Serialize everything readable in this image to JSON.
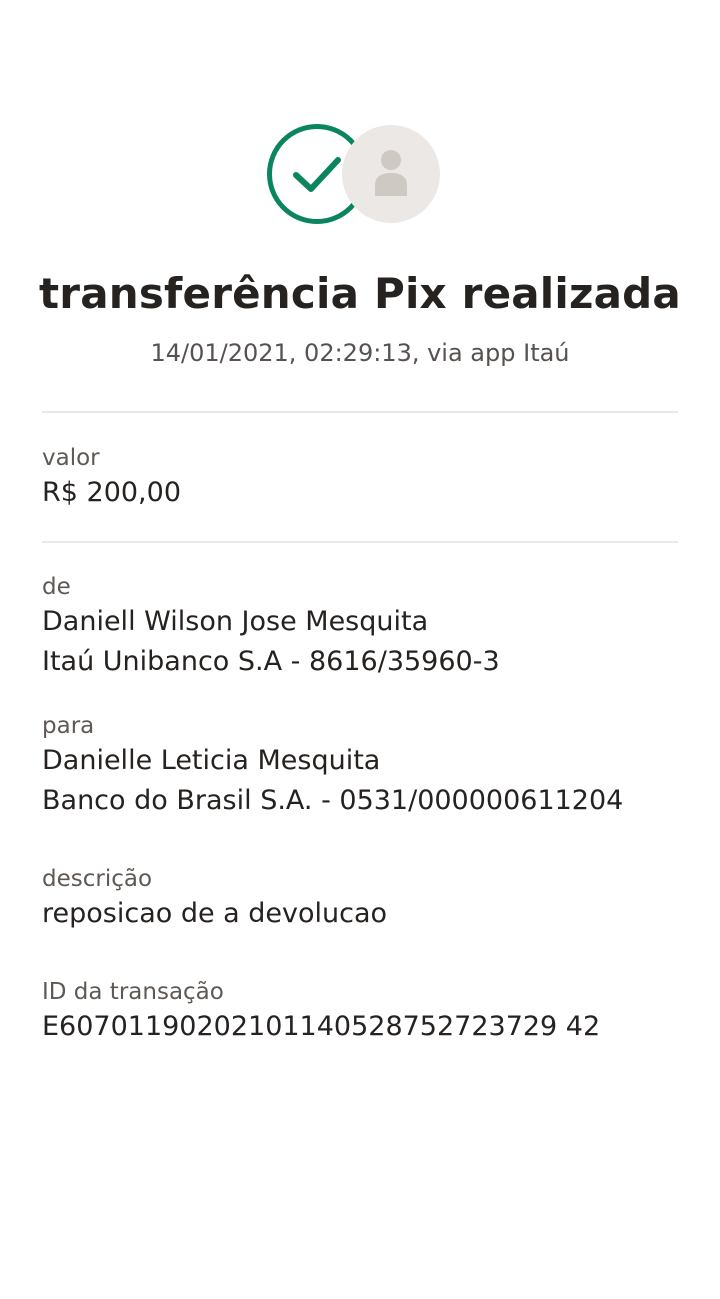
{
  "header": {
    "status_icon": "check-circle-icon",
    "recipient_icon": "person-avatar-icon",
    "title": "transferência Pix realizada",
    "subtitle": "14/01/2021,  02:29:13, via app Itaú"
  },
  "colors": {
    "success_green": "#0b855f",
    "avatar_bg": "#ece8e5",
    "avatar_fg": "#cfc9c4",
    "text_primary": "#252220",
    "text_secondary": "#5e5955",
    "divider": "#ebe8e6"
  },
  "amount": {
    "label": "valor",
    "value": "R$ 200,00"
  },
  "sender": {
    "label": "de",
    "name": "Daniell Wilson Jose Mesquita",
    "account": "Itaú Unibanco S.A - 8616/35960-3"
  },
  "recipient": {
    "label": "para",
    "name": "Danielle Leticia Mesquita",
    "account": "Banco do Brasil S.A. - 0531/000000611204"
  },
  "description": {
    "label": "descrição",
    "value": "reposicao de a devolucao"
  },
  "transaction": {
    "label": "ID da transação",
    "value": "E60701190202101140528752723729 42"
  }
}
